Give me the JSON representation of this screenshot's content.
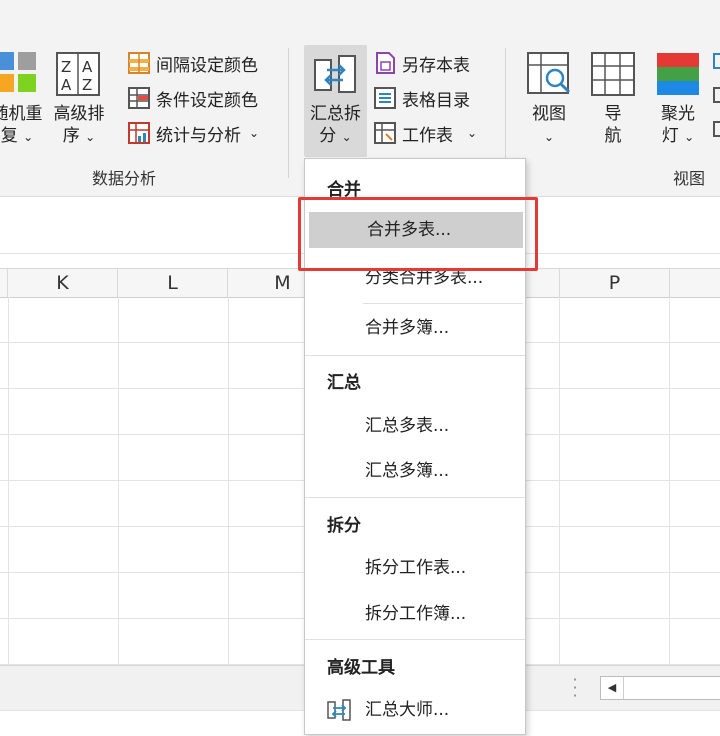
{
  "ribbon": {
    "random_reset": {
      "line1": "随机重",
      "line2": "复"
    },
    "advanced_sort": {
      "line1": "高级排",
      "line2": "序"
    },
    "interval_color": "间隔设定颜色",
    "conditional_color": "条件设定颜色",
    "stats_analysis": "统计与分析",
    "group_data_analysis": "数据分析",
    "merge_split": {
      "line1": "汇总拆",
      "line2": "分"
    },
    "save_as_sheet": "另存本表",
    "sheet_directory": "表格目录",
    "worksheet": "工作表",
    "view": {
      "line1": "视图"
    },
    "navigation": {
      "line1": "导",
      "line2": "航"
    },
    "spotlight": {
      "line1": "聚光",
      "line2": "灯"
    },
    "group_view": "视图"
  },
  "columns": [
    "K",
    "L",
    "M",
    "P"
  ],
  "menu": {
    "sections": [
      {
        "header": "合并",
        "items": [
          "合并多表...",
          "分类合并多表...",
          "合并多簿..."
        ]
      },
      {
        "header": "汇总",
        "items": [
          "汇总多表...",
          "汇总多簿..."
        ]
      },
      {
        "header": "拆分",
        "items": [
          "拆分工作表...",
          "拆分工作簿..."
        ]
      },
      {
        "header": "高级工具",
        "items": [
          "汇总大师..."
        ]
      }
    ],
    "highlighted_item": "合并多表..."
  },
  "colors": {
    "highlight_border": "#e53935",
    "menu_highlight": "#cfcfcf",
    "ribbon_bg": "#f3f3f3"
  },
  "icons": {
    "random_reset": "colored-squares-icon",
    "advanced_sort": "az-sort-icon",
    "merge_split": "merge-split-icon",
    "view": "view-grid-magnifier-icon",
    "navigation": "grid-icon",
    "spotlight": "spotlight-icon"
  }
}
